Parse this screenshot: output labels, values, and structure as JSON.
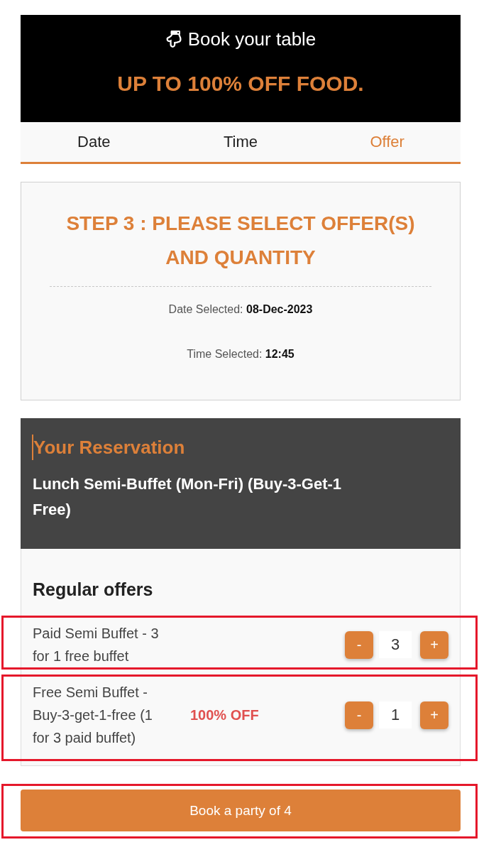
{
  "header": {
    "title": "Book your table",
    "headline": "UP TO 100% OFF FOOD."
  },
  "tabs": [
    {
      "label": "Date",
      "selected": false
    },
    {
      "label": "Time",
      "selected": false
    },
    {
      "label": "Offer",
      "selected": true
    }
  ],
  "step": {
    "title": "STEP 3 : PLEASE SELECT OFFER(S) AND QUANTITY",
    "details": [
      "Date Selected: **08-Dec-2023**",
      "Time Selected: **12:45**"
    ]
  },
  "reservation": {
    "title": "Your Reservation",
    "name": "Lunch Semi-Buffet (Mon-Fri) (Buy-3-Get-1 Free)"
  },
  "offers_section": {
    "title": "Regular offers",
    "offers": [
      {
        "description": "Paid Semi Buffet - 3 for 1 free buffet",
        "decrease_label": "-",
        "quantity": "3",
        "increase_label": "+",
        "highlighted": true
      },
      {
        "description": "Free Semi Buffet - Buy-3-get-1-free (1 for 3 paid buffet)",
        "discount": "100% OFF",
        "decrease_label": "-",
        "quantity": "1",
        "increase_label": "+",
        "highlighted": true
      }
    ]
  },
  "book_button": {
    "label": "Book a party of 4",
    "highlighted": true
  }
}
